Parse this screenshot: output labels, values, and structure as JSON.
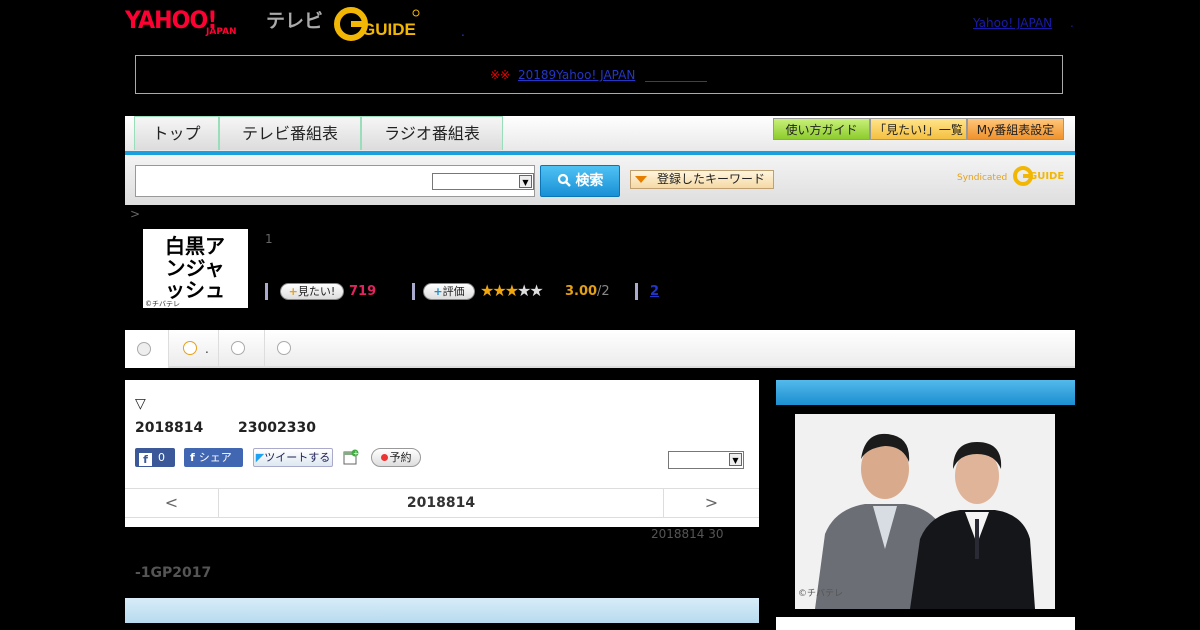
{
  "header": {
    "logo_main": "YAHOO!",
    "logo_sub": "JAPAN",
    "service": "テレビ",
    "gguide_logo": "G GUIDE",
    "dot": ".",
    "yahoo_link": "Yahoo! JAPAN",
    "yahoo_dot": "."
  },
  "notice": {
    "mark": "※※",
    "link": "20189Yahoo! JAPAN"
  },
  "nav": {
    "tabs": [
      "トップ",
      "テレビ番組表",
      "ラジオ番組表"
    ],
    "right_buttons": [
      "使い方ガイド",
      "「見たい!」一覧",
      "My番組表設定"
    ]
  },
  "search": {
    "input_value": "",
    "select_value": "",
    "button_label": "検索",
    "keyword_button": "登録したキーワード",
    "syndicated": "Syndicated",
    "syndicated_logo": "GUIDE"
  },
  "program": {
    "breadcrumb": ">",
    "number": "1",
    "thumb_title": "白黒アンジャッシュ",
    "thumb_copy": "©チバテレ",
    "mitai_label": "見たい!",
    "mitai_count": "719",
    "rate_label": "評価",
    "rating": 3,
    "rating_max": 5,
    "rating_value": "3.00",
    "rating_count": "/2",
    "review_link": "2"
  },
  "subtabs": {
    "tab2_label": "."
  },
  "detail": {
    "triangle": "▽",
    "date": "2018814",
    "time": "23002330",
    "fb_like_count": "0",
    "fb_share": "シェア",
    "tweet": "ツイートする",
    "reserve": "予約",
    "select_value": "",
    "prev": "<",
    "next": ">",
    "nav_date": "2018814",
    "air_info": "2018814  30",
    "gp": "-1GP2017"
  },
  "right": {
    "photo_copy": "©チバテレ"
  },
  "colors": {
    "accent_blue": "#1aa0dd",
    "yahoo_red": "#ff0033",
    "mitai_pink": "#e0245e",
    "star_gold": "#f2a60d",
    "link_blue": "#2436c7"
  }
}
